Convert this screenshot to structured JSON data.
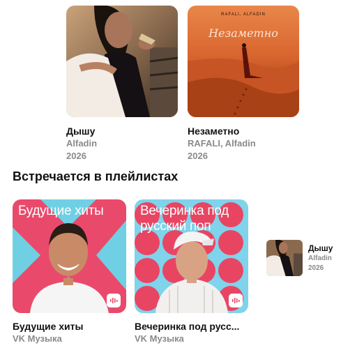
{
  "albums": [
    {
      "title": "Дышу",
      "artist": "Alfadin",
      "year": "2026"
    },
    {
      "title": "Незаметно",
      "artist": "RAFALI, Alfadin",
      "year": "2026",
      "cover_top_text": "RAFALI, ALFADIN",
      "cover_script_text": "Незаметно"
    }
  ],
  "section_title": "Встречается в плейлистах",
  "playlists": [
    {
      "cover_title": "Будущие хиты",
      "name": "Будущие хиты",
      "subtitle": "VK Музыка",
      "cover_color": "#e94a6b"
    },
    {
      "cover_title": "Вечеринка под русский поп",
      "name": "Вечеринка под русс...",
      "subtitle": "VK Музыка",
      "cover_color": "#e84563"
    }
  ],
  "mini_player": {
    "title": "Дышу",
    "artist": "Alfadin",
    "year": "2026"
  },
  "colors": {
    "accent_pink": "#e94a6b",
    "accent_cyan": "#6fd0e4",
    "muted_text": "#8a8a8a"
  },
  "icons": [
    "vk-music-badge-icon"
  ]
}
